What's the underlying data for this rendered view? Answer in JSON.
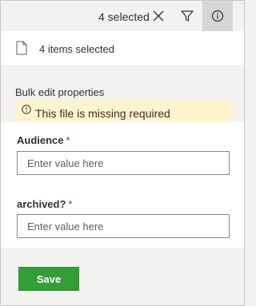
{
  "command_bar": {
    "selection_count": "4 selected",
    "icons": [
      "close-icon",
      "filter-icon",
      "info-icon"
    ]
  },
  "selection": {
    "label": "4 items selected",
    "icon": "document-icon"
  },
  "bulk_edit": {
    "heading": "Bulk edit properties",
    "warning_text": "This file is missing required",
    "warning_icon": "info-circle-icon"
  },
  "fields": [
    {
      "label": "Audience",
      "required_marker": "*",
      "placeholder": "Enter value here",
      "value": ""
    },
    {
      "label": "archived?",
      "required_marker": "*",
      "placeholder": "Enter value here",
      "value": ""
    }
  ],
  "footer": {
    "save_label": "Save"
  },
  "colors": {
    "save_button": "#339e35",
    "warning_background": "#fff4ce",
    "required_marker": "#a4262c",
    "active_icon_background": "#d7d6d5"
  }
}
